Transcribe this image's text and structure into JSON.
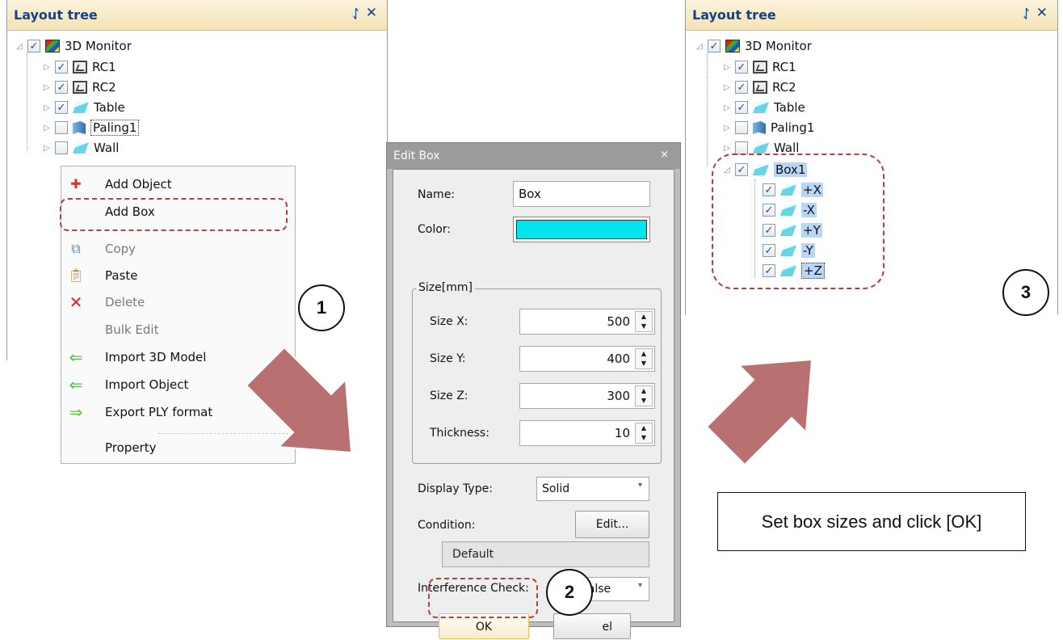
{
  "left_panel": {
    "title": "Layout tree",
    "pin_glyph": "ᛇ",
    "close_glyph": "✕",
    "tree": [
      {
        "label": "3D Monitor",
        "checked": true,
        "icon": "monitor-icon"
      },
      {
        "label": "RC1",
        "checked": true,
        "icon": "robot-controller-icon"
      },
      {
        "label": "RC2",
        "checked": true,
        "icon": "robot-controller-icon"
      },
      {
        "label": "Table",
        "checked": true,
        "icon": "box-object-icon"
      },
      {
        "label": "Paling1",
        "checked": false,
        "icon": "paling-icon"
      },
      {
        "label": "Wall",
        "checked": false,
        "icon": "box-object-icon"
      }
    ]
  },
  "context_menu": {
    "items": [
      {
        "label": "Add Object",
        "icon": "add-object-icon",
        "enabled": true
      },
      {
        "label": "Add Box",
        "icon": "",
        "enabled": true
      },
      {
        "label": "Copy",
        "icon": "copy-icon",
        "enabled": false
      },
      {
        "label": "Paste",
        "icon": "paste-icon",
        "enabled": true
      },
      {
        "label": "Delete",
        "icon": "delete-icon",
        "enabled": false
      },
      {
        "label": "Bulk Edit",
        "icon": "",
        "enabled": false
      },
      {
        "label": "Import 3D Model",
        "icon": "import-arrow-icon",
        "enabled": true
      },
      {
        "label": "Import Object",
        "icon": "import-arrow-icon",
        "enabled": true
      },
      {
        "label": "Export PLY format",
        "icon": "export-arrow-icon",
        "enabled": true
      },
      {
        "label": "Property",
        "icon": "",
        "enabled": true
      }
    ]
  },
  "dialog": {
    "title": "Edit Box",
    "close_glyph": "×",
    "name_label": "Name:",
    "name_value": "Box",
    "color_label": "Color:",
    "color_value": "#00e5ee",
    "size_group": "Size[mm]",
    "size_x_label": "Size X:",
    "size_x": "500",
    "size_y_label": "Size Y:",
    "size_y": "400",
    "size_z_label": "Size Z:",
    "size_z": "300",
    "thickness_label": "Thickness:",
    "thickness": "10",
    "display_type_label": "Display Type:",
    "display_type": "Solid",
    "condition_label": "Condition:",
    "condition_edit_button": "Edit...",
    "condition_value": "Default",
    "interference_label": "Interference Check:",
    "interference_value": "False",
    "ok_button": "OK",
    "cancel_button_visible": "el"
  },
  "right_panel": {
    "title": "Layout tree",
    "pin_glyph": "ᛇ",
    "close_glyph": "✕",
    "tree": [
      {
        "label": "3D Monitor",
        "checked": true
      },
      {
        "label": "RC1",
        "checked": true
      },
      {
        "label": "RC2",
        "checked": true
      },
      {
        "label": "Table",
        "checked": true
      },
      {
        "label": "Paling1",
        "checked": false
      },
      {
        "label": "Wall",
        "checked": false
      },
      {
        "label": "Box1",
        "checked": true
      },
      {
        "label": "+X",
        "checked": true
      },
      {
        "label": "-X",
        "checked": true
      },
      {
        "label": "+Y",
        "checked": true
      },
      {
        "label": "-Y",
        "checked": true
      },
      {
        "label": "+Z",
        "checked": true
      }
    ]
  },
  "annotations": {
    "step1": "1",
    "step2": "2",
    "step3": "3",
    "note": "Set box sizes and click [OK]",
    "arrow_color": "#b87070"
  }
}
